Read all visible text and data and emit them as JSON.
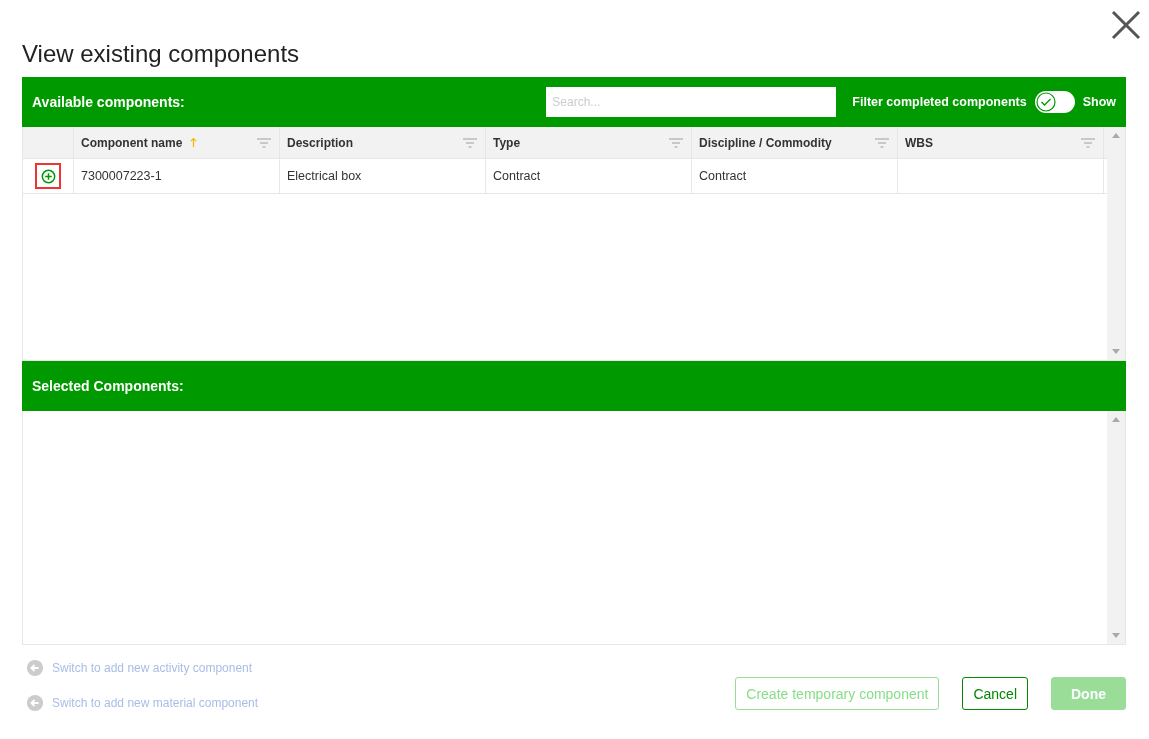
{
  "title": "View existing components",
  "available": {
    "heading": "Available components:",
    "search": {
      "placeholder": "Search..."
    },
    "filter": {
      "label": "Filter completed components",
      "on": false,
      "state_label": "Show"
    },
    "columns": [
      {
        "label": "Component name",
        "sorted": true
      },
      {
        "label": "Description",
        "sorted": false
      },
      {
        "label": "Type",
        "sorted": false
      },
      {
        "label": "Discipline / Commodity",
        "sorted": false
      },
      {
        "label": "WBS",
        "sorted": false
      }
    ],
    "rows": [
      {
        "highlighted": true,
        "cells": [
          "7300007223-1",
          "Electrical box",
          "Contract",
          "Contract",
          ""
        ]
      }
    ]
  },
  "selected": {
    "heading": "Selected Components:"
  },
  "links": [
    "Switch to add new activity component",
    "Switch to add new material component"
  ],
  "buttons": [
    {
      "label": "Create temporary component",
      "kind": "outline",
      "disabled": true
    },
    {
      "label": "Cancel",
      "kind": "outline",
      "disabled": false
    },
    {
      "label": "Done",
      "kind": "solid",
      "disabled": true
    }
  ]
}
